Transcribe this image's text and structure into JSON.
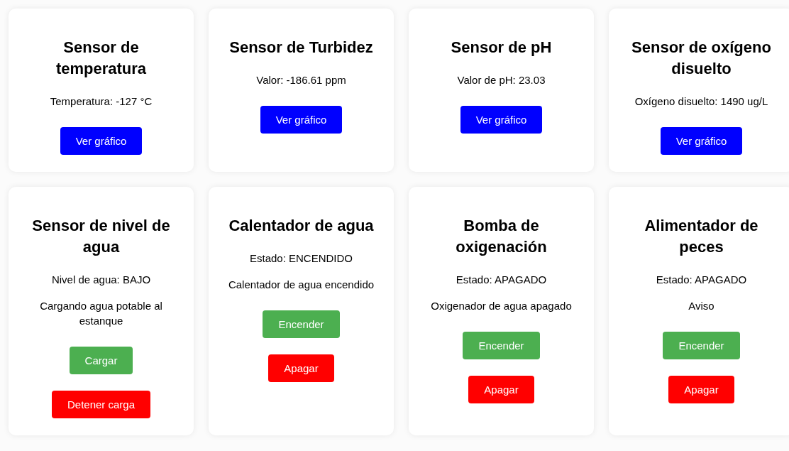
{
  "cards": [
    {
      "title": "Sensor de temperatura",
      "lines": [
        "Temperatura: -127 °C"
      ],
      "buttons": [
        {
          "label": "Ver gráfico",
          "kind": "primary"
        }
      ]
    },
    {
      "title": "Sensor de Turbidez",
      "lines": [
        "Valor: -186.61 ppm"
      ],
      "buttons": [
        {
          "label": "Ver gráfico",
          "kind": "primary"
        }
      ]
    },
    {
      "title": "Sensor de pH",
      "lines": [
        "Valor de pH: 23.03"
      ],
      "buttons": [
        {
          "label": "Ver gráfico",
          "kind": "primary"
        }
      ]
    },
    {
      "title": "Sensor de oxígeno disuelto",
      "lines": [
        "Oxígeno disuelto: 1490 ug/L"
      ],
      "buttons": [
        {
          "label": "Ver gráfico",
          "kind": "primary"
        }
      ]
    },
    {
      "title": "Sensor de nivel de agua",
      "lines": [
        "Nivel de agua: BAJO",
        "Cargando agua potable al estanque"
      ],
      "buttons": [
        {
          "label": "Cargar",
          "kind": "success"
        },
        {
          "label": "Detener carga",
          "kind": "danger"
        }
      ]
    },
    {
      "title": "Calentador de agua",
      "lines": [
        "Estado: ENCENDIDO",
        "Calentador de agua encendido"
      ],
      "buttons": [
        {
          "label": "Encender",
          "kind": "success"
        },
        {
          "label": "Apagar",
          "kind": "danger"
        }
      ]
    },
    {
      "title": "Bomba de oxigenación",
      "lines": [
        "Estado: APAGADO",
        "Oxigenador de agua apagado"
      ],
      "buttons": [
        {
          "label": "Encender",
          "kind": "success"
        },
        {
          "label": "Apagar",
          "kind": "danger"
        }
      ]
    },
    {
      "title": "Alimentador de peces",
      "lines": [
        "Estado: APAGADO",
        "Aviso"
      ],
      "buttons": [
        {
          "label": "Encender",
          "kind": "success"
        },
        {
          "label": "Apagar",
          "kind": "danger"
        }
      ]
    }
  ]
}
